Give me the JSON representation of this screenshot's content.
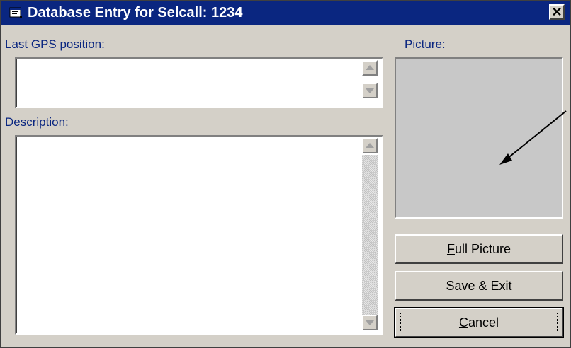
{
  "window": {
    "title": "Database Entry for Selcall: 1234",
    "close_label": "✕"
  },
  "labels": {
    "gps": "Last GPS position:",
    "description": "Description:",
    "picture": "Picture:"
  },
  "fields": {
    "gps_value": "",
    "description_value": ""
  },
  "buttons": {
    "full_picture": {
      "mnemonic": "F",
      "rest": "ull Picture"
    },
    "save_exit": {
      "mnemonic": "S",
      "rest": "ave & Exit"
    },
    "cancel": {
      "mnemonic": "C",
      "rest": "ancel"
    }
  },
  "icons": [
    "window-app-icon",
    "close-icon",
    "scroll-up-icon",
    "scroll-down-icon",
    "pointer-arrow-icon"
  ],
  "colors": {
    "titlebar": "#0a2680",
    "face": "#d4d0c8",
    "label": "#0a2680"
  }
}
